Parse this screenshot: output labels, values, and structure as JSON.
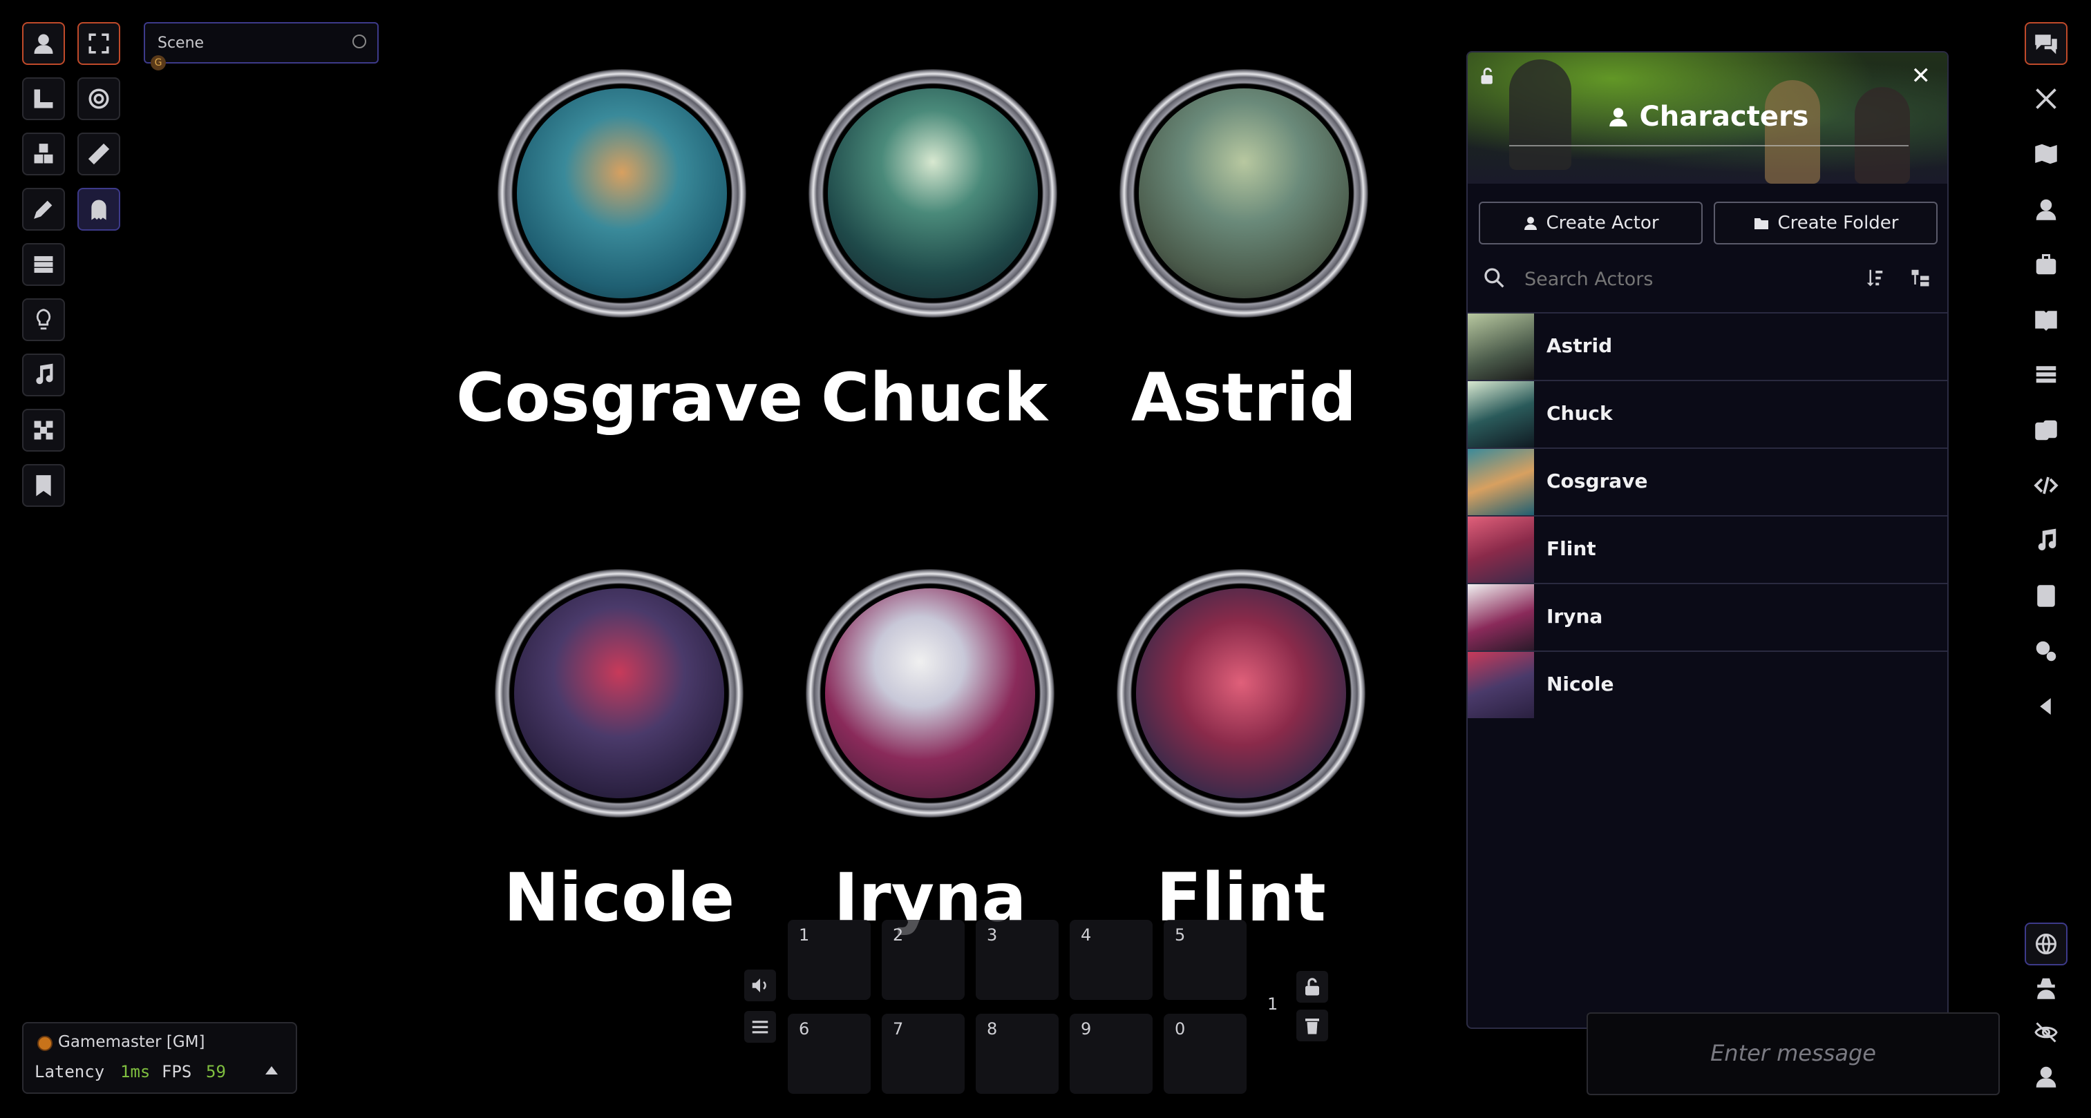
{
  "scene": {
    "placeholder": "Scene",
    "badge": "G"
  },
  "tokens": [
    {
      "name": "Cosgrave"
    },
    {
      "name": "Chuck"
    },
    {
      "name": "Astrid"
    },
    {
      "name": "Nicole"
    },
    {
      "name": "Iryna"
    },
    {
      "name": "Flint"
    }
  ],
  "hotbar": {
    "row1": [
      "1",
      "2",
      "3",
      "4",
      "5"
    ],
    "row2": [
      "6",
      "7",
      "8",
      "9",
      "0"
    ],
    "page": "1"
  },
  "players": {
    "user": "Gamemaster [GM]",
    "latency_label": "Latency",
    "latency_value": "1ms",
    "fps_label": "FPS",
    "fps_value": "59"
  },
  "panel": {
    "title": "Characters",
    "create_actor": "Create Actor",
    "create_folder": "Create Folder",
    "search_placeholder": "Search Actors",
    "actors": [
      "Astrid",
      "Chuck",
      "Cosgrave",
      "Flint",
      "Iryna",
      "Nicole"
    ]
  },
  "chat": {
    "placeholder": "Enter message"
  },
  "colors": {
    "accent": "#3d3a8a",
    "active": "#c04a2a",
    "fps": "#7fbf3f"
  }
}
